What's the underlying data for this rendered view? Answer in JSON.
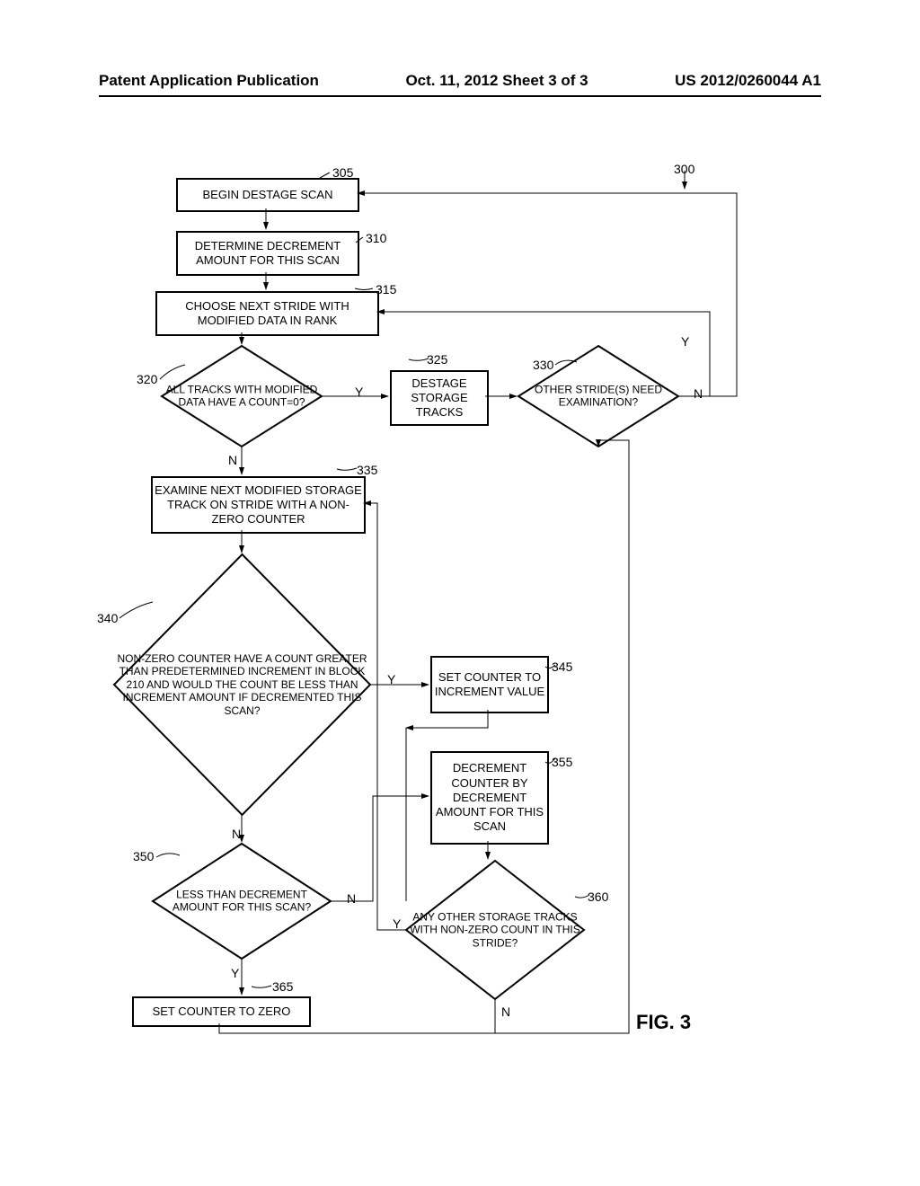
{
  "header": {
    "left": "Patent Application Publication",
    "center": "Oct. 11, 2012   Sheet 3 of 3",
    "right": "US 2012/0260044 A1"
  },
  "labels": {
    "r300": "300",
    "r305": "305",
    "r310": "310",
    "r315": "315",
    "r320": "320",
    "r325": "325",
    "r330": "330",
    "r335": "335",
    "r340": "340",
    "r345": "345",
    "r350": "350",
    "r355": "355",
    "r360": "360",
    "r365": "365",
    "Y": "Y",
    "N": "N",
    "fig": "FIG. 3"
  },
  "boxes": {
    "b305": "BEGIN DESTAGE SCAN",
    "b310": "DETERMINE DECREMENT AMOUNT FOR THIS SCAN",
    "b315": "CHOOSE NEXT STRIDE WITH MODIFIED DATA IN RANK",
    "b325": "DESTAGE STORAGE TRACKS",
    "b335": "EXAMINE NEXT MODIFIED STORAGE TRACK ON STRIDE WITH A NON-ZERO COUNTER",
    "b345": "SET COUNTER TO INCREMENT VALUE",
    "b355": "DECREMENT COUNTER BY DECREMENT AMOUNT FOR THIS SCAN",
    "b365": "SET COUNTER TO ZERO"
  },
  "diamonds": {
    "d320": "ALL TRACKS WITH MODIFIED DATA HAVE A COUNT=0?",
    "d330": "OTHER STRIDE(S) NEED EXAMINATION?",
    "d340": "NON-ZERO COUNTER HAVE A COUNT GREATER THAN PREDETERMINED INCREMENT IN BLOCK 210 AND WOULD THE COUNT BE LESS THAN INCREMENT AMOUNT IF DECREMENTED THIS SCAN?",
    "d350": "LESS THAN DECREMENT AMOUNT FOR THIS SCAN?",
    "d360": "ANY OTHER STORAGE TRACKS WITH NON-ZERO COUNT IN THIS STRIDE?"
  }
}
